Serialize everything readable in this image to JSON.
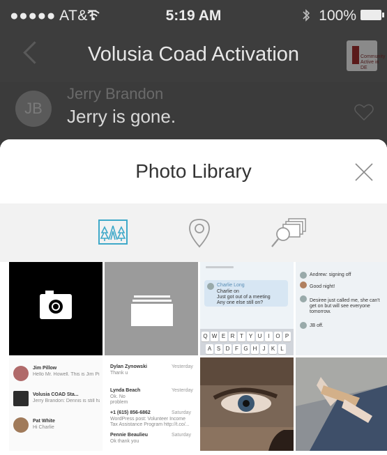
{
  "status_bar": {
    "carrier": "●●●●● AT&T",
    "time": "5:19 AM",
    "battery": "100%"
  },
  "nav": {
    "title": "Volusia Coad Activation",
    "logo_text": "Community Active in DE"
  },
  "chat": {
    "avatar_initials": "JB",
    "sender": "Jerry Brandon",
    "message": "Jerry is gone."
  },
  "sheet": {
    "title": "Photo Library",
    "tabs": [
      {
        "name": "library-tab",
        "icon": "forest-icon",
        "selected": true
      },
      {
        "name": "places-tab",
        "icon": "location-pin-icon",
        "selected": false
      },
      {
        "name": "search-tab",
        "icon": "search-photos-icon",
        "selected": false
      }
    ],
    "accent_color": "#3fa9c9"
  },
  "thumbnails": {
    "chat_screenshot": {
      "sender": "Charlie Long",
      "line1": "Charlie on",
      "line2": "Just got out of a meeting",
      "line3": "Any one else still on?",
      "keys": [
        "Q",
        "W",
        "E",
        "R",
        "T",
        "Y",
        "U",
        "I",
        "O",
        "P",
        "A",
        "S",
        "D",
        "F",
        "G",
        "H",
        "J",
        "K",
        "L"
      ]
    },
    "group_screenshot": {
      "line1": "Andrew: signing off",
      "line2": "Good night!",
      "line3": "Desiree just called me, she can't get on but will see everyone tomorrow.",
      "line4": "JB off."
    },
    "list_screenshot": {
      "items": [
        {
          "title": "Jim Pillow",
          "sub": "Hello Mr. Howell. This is Jim Pillow a New COAD..."
        },
        {
          "title": "Volusia COAD Sta...",
          "sub": "Jerry Brandon: Dennis is still having a problem ge..."
        },
        {
          "title": "Pat White",
          "sub": "Hi Charlie"
        }
      ]
    },
    "messages_screenshot": {
      "items": [
        {
          "name": "Dylan Zynowski",
          "time": "Yesterday",
          "sub": "Thank u"
        },
        {
          "name": "Lynda Beach",
          "time": "Yesterday",
          "sub": "Ok. No problem"
        },
        {
          "name": "+1 (615) 856-6862",
          "time": "Saturday",
          "sub": "WordPress post: Volunteer Income Tax Assistance Program http://t.co/..."
        },
        {
          "name": "Pennie Beaulieu",
          "time": "Saturday",
          "sub": "Ok thank you"
        }
      ]
    }
  }
}
